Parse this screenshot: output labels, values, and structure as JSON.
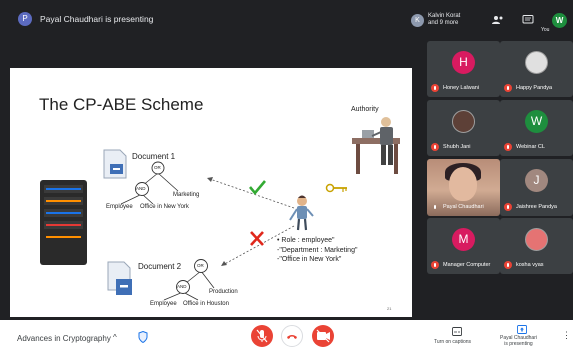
{
  "topbar": {
    "presenter_initial": "P",
    "presenting_text": "Payal Chaudhari is presenting",
    "people_initial": "K",
    "people_name": "Kalvin Korat",
    "people_more": "and 9 more",
    "you_initial": "W",
    "you_label": "You"
  },
  "slide": {
    "title": "The CP-ABE Scheme",
    "authority": "Authority",
    "document1": "Document 1",
    "document2": "Document 2",
    "or1": "OR",
    "and1": "AND",
    "marketing": "Marketing",
    "employee1": "Employee",
    "office_ny": "Office in New York",
    "or2": "OR",
    "and2": "AND",
    "production": "Production",
    "employee2": "Employee",
    "office_houston": "Office in Houston",
    "attrs": [
      "• Role : employee\"",
      "-\"Department : Marketing\"",
      "-\"Office in New York\""
    ],
    "page_number": "21"
  },
  "participants": [
    {
      "initial": "H",
      "name": "Honey Lalwani",
      "color": "#d81b60",
      "type": "avatar"
    },
    {
      "initial": "",
      "name": "Happy Pandya",
      "color": "#e0e0e0",
      "type": "photo"
    },
    {
      "initial": "",
      "name": "Shubh Jani",
      "color": "#5d4037",
      "type": "photo"
    },
    {
      "initial": "W",
      "name": "Webinar CL",
      "color": "#1e8e3e",
      "type": "avatar"
    },
    {
      "initial": "",
      "name": "Payal Chaudhari",
      "color": "#c9a58f",
      "type": "video"
    },
    {
      "initial": "J",
      "name": "Jaishree Pandya",
      "color": "#a1887f",
      "type": "avatar"
    },
    {
      "initial": "M",
      "name": "Manager Computer",
      "color": "#d81b60",
      "type": "avatar"
    },
    {
      "initial": "",
      "name": "kosha vyas",
      "color": "#e57373",
      "type": "photo"
    }
  ],
  "bottombar": {
    "meeting_title": "Advances in Cryptography",
    "captions_label": "Turn on captions",
    "presenting_label": "Payal Chaudhari",
    "presenting_sub": "is presenting"
  },
  "colors": {
    "dark_bg": "#202124",
    "tile_bg": "#3c4043",
    "mute_red": "#ea4335",
    "check_green": "#33aa33",
    "cross_red": "#e0281c"
  }
}
